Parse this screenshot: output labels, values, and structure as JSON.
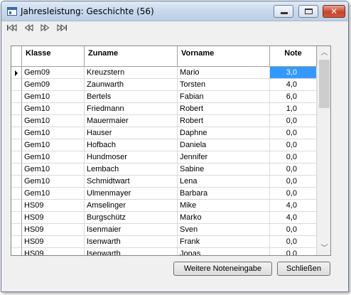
{
  "window": {
    "title": "Jahresleistung: Geschichte (56)"
  },
  "navigation": {
    "first": "first-record-icon",
    "prev": "previous-record-icon",
    "next": "next-record-icon",
    "last": "last-record-icon"
  },
  "grid": {
    "columns": [
      "Klasse",
      "Zuname",
      "Vorname",
      "Note"
    ],
    "rows": [
      {
        "klasse": "Gem09",
        "zuname": "Kreuzstern",
        "vorname": "Mario",
        "note": "3,0"
      },
      {
        "klasse": "Gem09",
        "zuname": "Zaunwarth",
        "vorname": "Torsten",
        "note": "4,0"
      },
      {
        "klasse": "Gem10",
        "zuname": "Bertels",
        "vorname": "Fabian",
        "note": "6,0"
      },
      {
        "klasse": "Gem10",
        "zuname": "Friedmann",
        "vorname": "Robert",
        "note": "1,0"
      },
      {
        "klasse": "Gem10",
        "zuname": "Mauermaier",
        "vorname": "Robert",
        "note": "0,0"
      },
      {
        "klasse": "Gem10",
        "zuname": "Hauser",
        "vorname": "Daphne",
        "note": "0,0"
      },
      {
        "klasse": "Gem10",
        "zuname": "Hofbach",
        "vorname": "Daniela",
        "note": "0,0"
      },
      {
        "klasse": "Gem10",
        "zuname": "Hundmoser",
        "vorname": "Jennifer",
        "note": "0,0"
      },
      {
        "klasse": "Gem10",
        "zuname": "Lembach",
        "vorname": "Sabine",
        "note": "0,0"
      },
      {
        "klasse": "Gem10",
        "zuname": "Schmidtwart",
        "vorname": "Lena",
        "note": "0,0"
      },
      {
        "klasse": "Gem10",
        "zuname": "Ulmenmayer",
        "vorname": "Barbara",
        "note": "0,0"
      },
      {
        "klasse": "HS09",
        "zuname": "Amselinger",
        "vorname": "Mike",
        "note": "4,0"
      },
      {
        "klasse": "HS09",
        "zuname": "Burgschütz",
        "vorname": "Marko",
        "note": "4,0"
      },
      {
        "klasse": "HS09",
        "zuname": "Isenmaier",
        "vorname": "Sven",
        "note": "0,0"
      },
      {
        "klasse": "HS09",
        "zuname": "Isenwarth",
        "vorname": "Frank",
        "note": "0,0"
      },
      {
        "klasse": "HS09",
        "zuname": "Isenwarth",
        "vorname": "Jonas",
        "note": "0,0"
      }
    ],
    "selected_row": 0,
    "selection_color": "#3399ff"
  },
  "buttons": {
    "more_grades": "Weitere Noteneingabe",
    "close": "Schließen"
  }
}
